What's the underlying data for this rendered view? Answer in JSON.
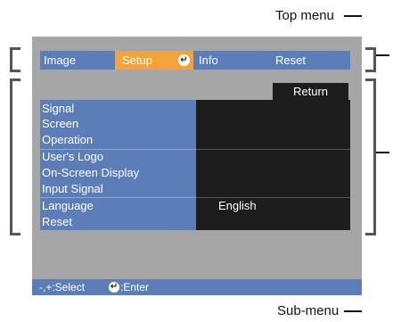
{
  "callouts": {
    "top_menu": "Top menu",
    "sub_menu": "Sub-menu"
  },
  "top_menu": {
    "tabs": [
      {
        "label": "Image",
        "selected": false
      },
      {
        "label": "Setup",
        "selected": true
      },
      {
        "label": "Info",
        "selected": false
      },
      {
        "label": "Reset",
        "selected": false
      }
    ],
    "enter_icon": "enter-icon"
  },
  "sub_menu": {
    "return_label": "Return",
    "items": [
      {
        "label": "Signal"
      },
      {
        "label": "Screen"
      },
      {
        "label": "Operation"
      },
      {
        "label": "User's Logo"
      },
      {
        "label": "On-Screen Display"
      },
      {
        "label": "Input Signal"
      },
      {
        "label": "Language",
        "value": "English"
      },
      {
        "label": "Reset"
      }
    ]
  },
  "footer": {
    "select_hint": "-,+:Select",
    "enter_hint": ":Enter",
    "enter_icon": "enter-icon"
  },
  "colors": {
    "menu_blue": "#5b7eb8",
    "selected_orange": "#f2a43c",
    "panel_gray": "#a6a6a6",
    "value_black": "#1d1d1d"
  }
}
